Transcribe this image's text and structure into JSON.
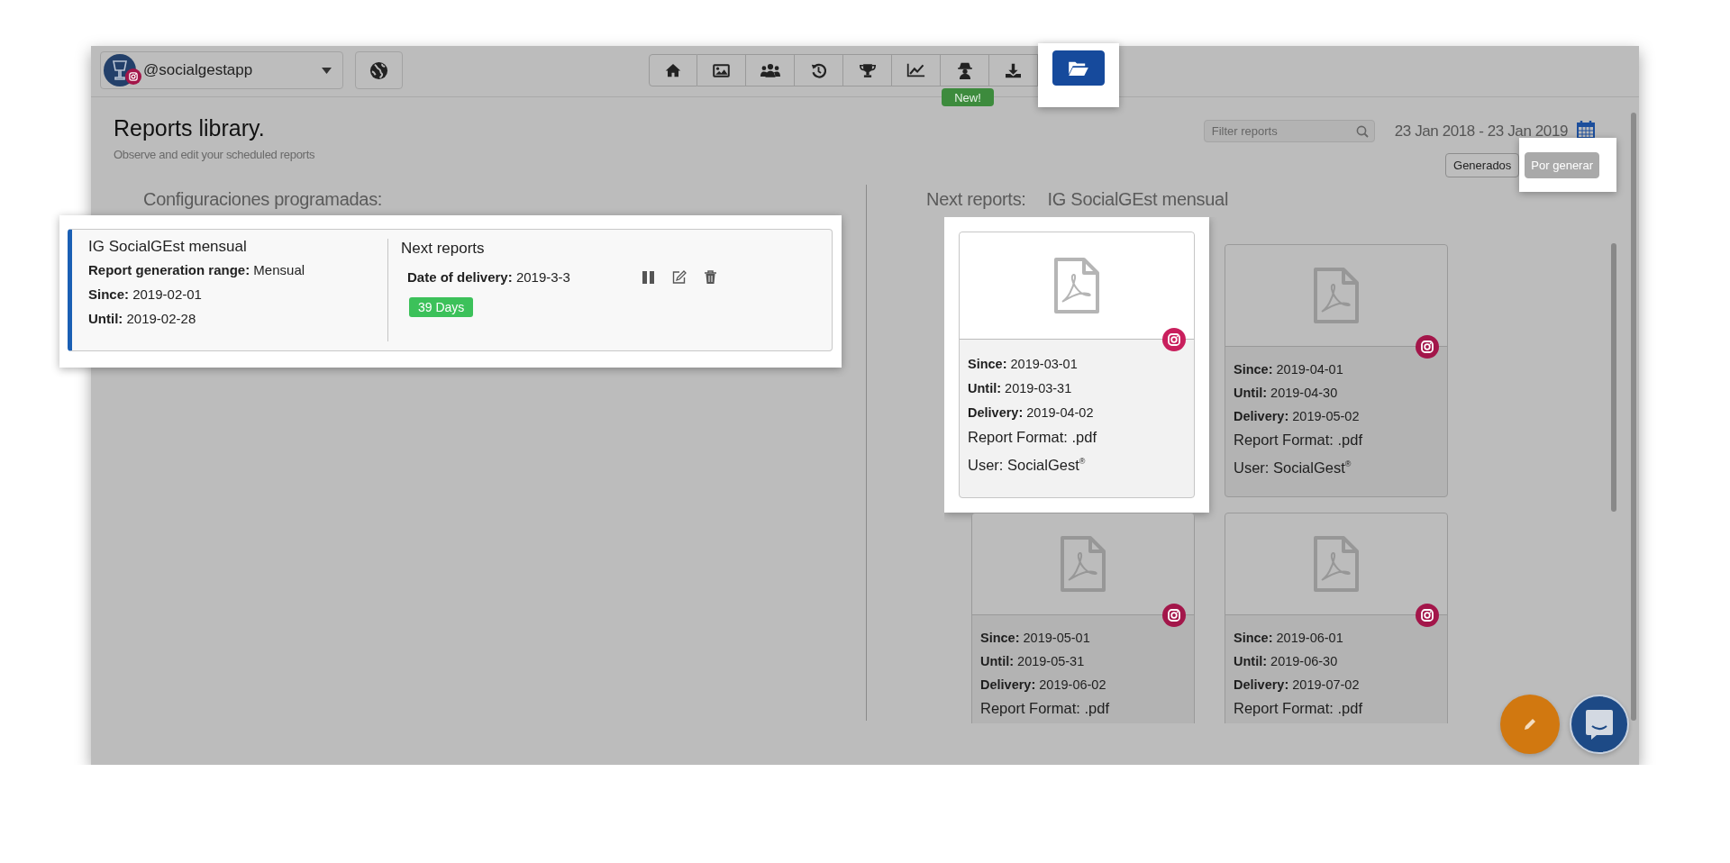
{
  "account": {
    "handle": "@socialgestapp"
  },
  "toolbar": [
    {
      "kind": "home",
      "selected": false,
      "highlighted": false
    },
    {
      "kind": "image",
      "selected": false,
      "highlighted": false
    },
    {
      "kind": "users",
      "selected": false,
      "highlighted": false
    },
    {
      "kind": "history",
      "selected": false,
      "highlighted": false
    },
    {
      "kind": "trophy",
      "selected": false,
      "highlighted": false
    },
    {
      "kind": "chart",
      "selected": false,
      "highlighted": false
    },
    {
      "kind": "spy",
      "selected": false,
      "highlighted": false,
      "badge": "New!"
    },
    {
      "kind": "download",
      "selected": false,
      "highlighted": false
    },
    {
      "kind": "folder",
      "selected": true,
      "highlighted": true
    }
  ],
  "page": {
    "title": "Reports library.",
    "subtitle": "Observe and edit your scheduled reports"
  },
  "filter": {
    "placeholder": "Filter reports"
  },
  "date_range": "23 Jan 2018 - 23 Jan 2019",
  "view_toggle": [
    {
      "label": "Generados",
      "selected": false,
      "highlighted": false
    },
    {
      "label": "Por generar",
      "selected": true,
      "highlighted": true
    }
  ],
  "configurations": {
    "heading": "Configuraciones programadas:",
    "items": [
      {
        "name": "IG SocialGEst mensual",
        "highlighted": true,
        "fields": [
          "**Report generation range:** Mensual",
          "**Since:** 2019-02-01",
          "**Until:** 2019-02-28"
        ],
        "next_heading": "Next reports",
        "delivery": "**Date of delivery:** 2019-3-3",
        "countdown": "39 Days"
      }
    ]
  },
  "next_reports": {
    "heading": "Next reports:",
    "config_name": "IG SocialGEst mensual",
    "cards": [
      {
        "highlighted": true,
        "fields": [
          "**Since:** 2019-03-01",
          "**Until:** 2019-03-31",
          "**Delivery:** 2019-04-02"
        ],
        "lines": [
          "Report Format: .pdf",
          "User: SocialGest$^{®}$"
        ]
      },
      {
        "highlighted": false,
        "fields": [
          "**Since:** 2019-04-01",
          "**Until:** 2019-04-30",
          "**Delivery:** 2019-05-02"
        ],
        "lines": [
          "Report Format: .pdf",
          "User: SocialGest$^{®}$"
        ]
      },
      {
        "highlighted": false,
        "fields": [
          "**Since:** 2019-05-01",
          "**Until:** 2019-05-31",
          "**Delivery:** 2019-06-02"
        ],
        "lines": [
          "Report Format: .pdf"
        ]
      },
      {
        "highlighted": false,
        "fields": [
          "**Since:** 2019-06-01",
          "**Until:** 2019-06-30",
          "**Delivery:** 2019-07-02"
        ],
        "lines": [
          "Report Format: .pdf"
        ]
      }
    ]
  }
}
